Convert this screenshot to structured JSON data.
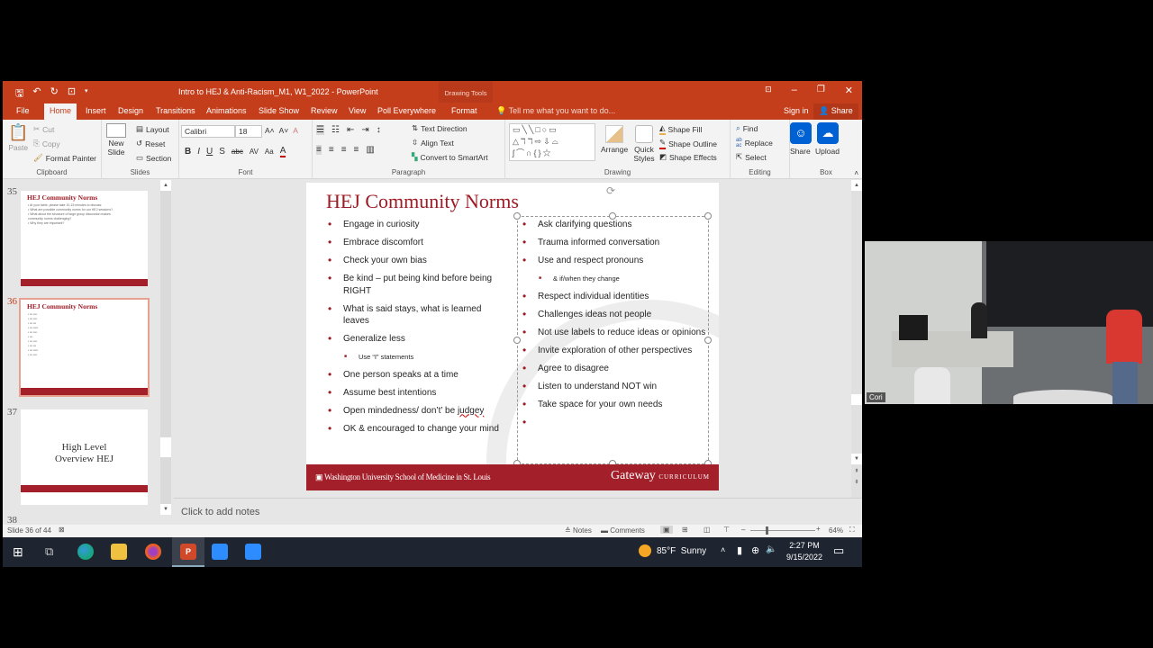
{
  "window": {
    "title": "Intro to HEJ & Anti-Racism_M1, W1_2022 - PowerPoint",
    "context_tab_group": "Drawing Tools"
  },
  "tabs": [
    "File",
    "Home",
    "Insert",
    "Design",
    "Transitions",
    "Animations",
    "Slide Show",
    "Review",
    "View",
    "Poll Everywhere",
    "Format"
  ],
  "active_tab": "Home",
  "tell_me_placeholder": "Tell me what you want to do...",
  "sign_in": "Sign in",
  "share": "Share",
  "ribbon": {
    "clipboard": {
      "label": "Clipboard",
      "paste": "Paste",
      "cut": "Cut",
      "copy": "Copy",
      "format_painter": "Format Painter"
    },
    "slides": {
      "label": "Slides",
      "new_slide": "New Slide",
      "layout": "Layout",
      "reset": "Reset",
      "section": "Section"
    },
    "font": {
      "label": "Font",
      "font_name": "Calibri",
      "font_size": "18"
    },
    "paragraph": {
      "label": "Paragraph",
      "text_direction": "Text Direction",
      "align_text": "Align Text",
      "convert_smartart": "Convert to SmartArt"
    },
    "drawing": {
      "label": "Drawing",
      "arrange": "Arrange",
      "quick_styles": "Quick Styles",
      "shape_fill": "Shape Fill",
      "shape_outline": "Shape Outline",
      "shape_effects": "Shape Effects"
    },
    "editing": {
      "label": "Editing",
      "find": "Find",
      "replace": "Replace",
      "select": "Select"
    },
    "box": {
      "label": "Box",
      "share": "Share",
      "upload": "Upload"
    }
  },
  "thumbnails": [
    {
      "num": "35",
      "title": "HEJ Community Norms",
      "lines": [
        "• At your table, please take 10-15 minutes to discuss:",
        "   • What are possible community norms for our HEJ sessions?",
        "   • What about the structure of large group discussion makes",
        "     community norms challenging?",
        "   • Why they are important?"
      ]
    },
    {
      "num": "36",
      "title": "HEJ Community Norms",
      "selected": true
    },
    {
      "num": "37",
      "title": "High Level Overview HEJ"
    },
    {
      "num": "38"
    }
  ],
  "slide": {
    "title": "HEJ Community Norms",
    "left_items": [
      {
        "text": "Engage in curiosity"
      },
      {
        "text": "Embrace discomfort"
      },
      {
        "text": "Check your own bias"
      },
      {
        "text": "Be kind – put being kind before being RIGHT"
      },
      {
        "text": "What is said stays, what is learned leaves"
      },
      {
        "text": "Generalize less"
      },
      {
        "text": "Use “I” statements",
        "sub": true
      },
      {
        "text": "One person speaks at a time"
      },
      {
        "text": "Assume best intentions"
      },
      {
        "text": "Open mindedness/ don’t’ be judgey"
      },
      {
        "text": "OK & encouraged to change your mind"
      }
    ],
    "right_items": [
      {
        "text": "Ask clarifying questions"
      },
      {
        "text": "Trauma informed conversation"
      },
      {
        "text": "Use and respect pronouns"
      },
      {
        "text": "& if/when they change",
        "sub": true
      },
      {
        "text": "Respect individual identities"
      },
      {
        "text": "Challenges ideas not people"
      },
      {
        "text": "Not use labels to reduce ideas or opinions"
      },
      {
        "text": "Invite exploration of other perspectives"
      },
      {
        "text": "Agree to disagree"
      },
      {
        "text": "Listen to understand NOT win"
      },
      {
        "text": "Take space for your own needs"
      },
      {
        "text": ""
      }
    ],
    "footer_left": "Washington University School of Medicine in St. Louis",
    "footer_right_main": "Gateway",
    "footer_right_sub": "CURRICULUM"
  },
  "notes_placeholder": "Click to add notes",
  "status": {
    "slide_info": "Slide 36 of 44",
    "notes": "Notes",
    "comments": "Comments",
    "zoom": "64%"
  },
  "taskbar": {
    "weather_temp": "85°F",
    "weather_cond": "Sunny",
    "time": "2:27 PM",
    "date": "9/15/2022"
  },
  "video": {
    "participant_name": "Cori"
  },
  "colors": {
    "ppt_accent": "#c43e1c",
    "slide_red": "#a31f2a",
    "title_red": "#9c1c24",
    "box_blue": "#0061d5"
  }
}
